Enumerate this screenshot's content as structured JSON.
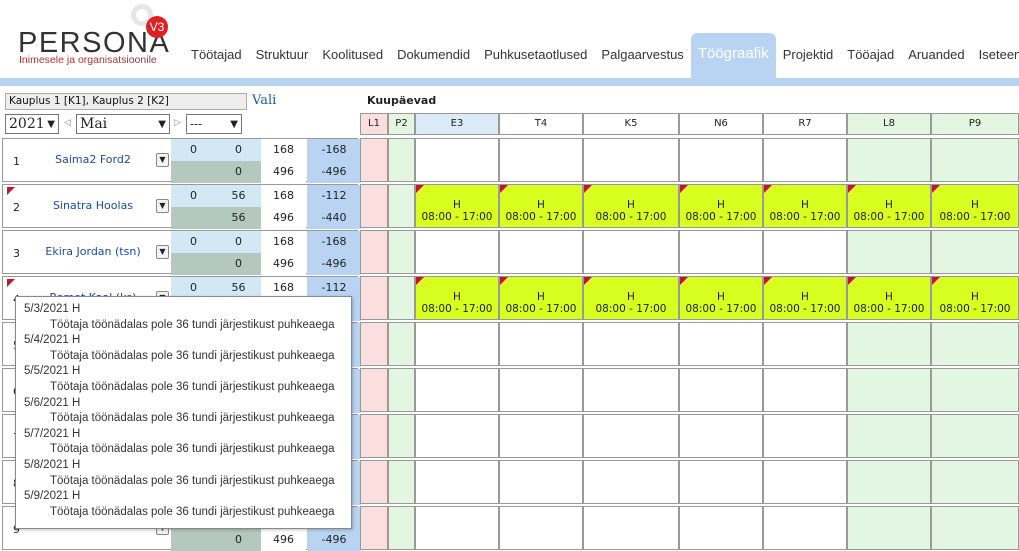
{
  "brand": {
    "name": "PERSONA",
    "badge": "V3",
    "tagline": "Inimesele ja organisatsioonile"
  },
  "nav": [
    "Töötajad",
    "Struktuur",
    "Koolitused",
    "Dokumendid",
    "Puhkusetaotlused",
    "Palgaarvestus",
    "Töögraafik",
    "Projektid",
    "Tööajad",
    "Aruanded",
    "Iseteenindus"
  ],
  "nav_active": "Töögraafik",
  "filters": {
    "stores": "Kauplus 1 [K1], Kauplus 2 [K2]",
    "vali": "Vali",
    "year": "2021",
    "month": "Mai",
    "extra": "---"
  },
  "calendar": {
    "title": "Kuupäevad",
    "days": [
      "L1",
      "P2",
      "E3",
      "T4",
      "K5",
      "N6",
      "R7",
      "L8",
      "P9"
    ]
  },
  "employees": [
    {
      "num": "1",
      "name": "Saima2 Ford2",
      "r1": [
        "0",
        "0",
        "168",
        "-168"
      ],
      "r2": [
        "0",
        "496",
        "-496"
      ],
      "flag": false,
      "shift": false
    },
    {
      "num": "2",
      "name": "Sinatra Hoolas",
      "r1": [
        "0",
        "56",
        "168",
        "-112"
      ],
      "r2": [
        "56",
        "496",
        "-440"
      ],
      "flag": true,
      "shift": true
    },
    {
      "num": "3",
      "name": "Ekira Jordan (tsn)",
      "r1": [
        "0",
        "0",
        "168",
        "-168"
      ],
      "r2": [
        "0",
        "496",
        "-496"
      ],
      "flag": false,
      "shift": false
    },
    {
      "num": "4",
      "name": "Romet Kaal (ks)",
      "r1": [
        "0",
        "56",
        "168",
        "-112"
      ],
      "r2": [
        "",
        "",
        ""
      ],
      "flag": true,
      "shift": true
    },
    {
      "num": "5",
      "name": "",
      "r1": [
        "",
        "",
        "",
        ""
      ],
      "r2": [
        "",
        "",
        ""
      ],
      "flag": false,
      "shift": false
    },
    {
      "num": "6",
      "name": "",
      "r1": [
        "",
        "",
        "",
        ""
      ],
      "r2": [
        "",
        "",
        ""
      ],
      "flag": false,
      "shift": false
    },
    {
      "num": "7",
      "name": "",
      "r1": [
        "",
        "",
        "",
        ""
      ],
      "r2": [
        "",
        "",
        ""
      ],
      "flag": false,
      "shift": false
    },
    {
      "num": "8",
      "name": "",
      "r1": [
        "",
        "",
        "",
        ""
      ],
      "r2": [
        "",
        "",
        ""
      ],
      "flag": false,
      "shift": false
    },
    {
      "num": "9",
      "name": "",
      "r1": [
        "",
        "",
        "",
        ""
      ],
      "r2": [
        "0",
        "496",
        "-496"
      ],
      "flag": false,
      "shift": false
    }
  ],
  "shift_entry": {
    "code": "H",
    "time": "08:00 - 17:00"
  },
  "tooltip": [
    {
      "date": "5/3/2021 H",
      "msg": "Töötaja töönädalas pole 36 tundi järjestikust puhkeaega"
    },
    {
      "date": "5/4/2021 H",
      "msg": "Töötaja töönädalas pole 36 tundi järjestikust puhkeaega"
    },
    {
      "date": "5/5/2021 H",
      "msg": "Töötaja töönädalas pole 36 tundi järjestikust puhkeaega"
    },
    {
      "date": "5/6/2021 H",
      "msg": "Töötaja töönädalas pole 36 tundi järjestikust puhkeaega"
    },
    {
      "date": "5/7/2021 H",
      "msg": "Töötaja töönädalas pole 36 tundi järjestikust puhkeaega"
    },
    {
      "date": "5/8/2021 H",
      "msg": "Töötaja töönädalas pole 36 tundi järjestikust puhkeaega"
    },
    {
      "date": "5/9/2021 H",
      "msg": "Töötaja töönädalas pole 36 tundi järjestikust puhkeaega"
    }
  ],
  "colors": {
    "weekend_sat": "#fbdede",
    "weekend_sun": "#e2f6e2",
    "shift": "#d8ff20",
    "flag": "#c0172d",
    "accent": "#b9d4f2"
  }
}
